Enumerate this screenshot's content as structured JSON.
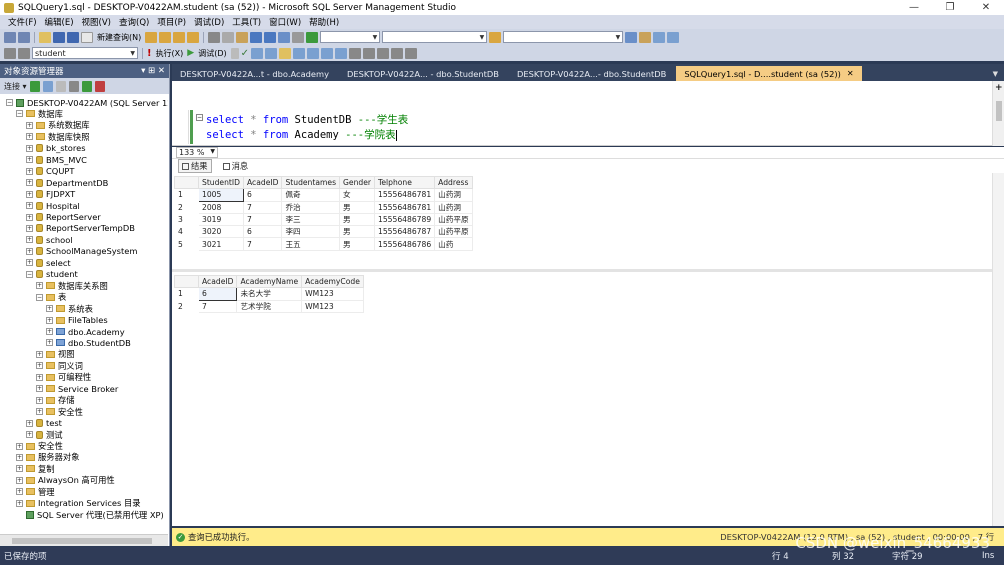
{
  "window": {
    "title": "SQLQuery1.sql - DESKTOP-V0422AM.student (sa (52)) - Microsoft SQL Server Management Studio",
    "minimize": "—",
    "maximize": "❐",
    "close": "✕"
  },
  "menu": [
    "文件(F)",
    "编辑(E)",
    "视图(V)",
    "查询(Q)",
    "项目(P)",
    "调试(D)",
    "工具(T)",
    "窗口(W)",
    "帮助(H)"
  ],
  "toolbar": {
    "new_query": "新建查询(N)",
    "database": "student",
    "execute": "执行(X)",
    "debug": "调试(D)"
  },
  "object_explorer": {
    "title": "对象资源管理器",
    "pin": "▾ ⊞ ✕",
    "connect": "连接 ▾",
    "tree": [
      {
        "label": "DESKTOP-V0422AM (SQL Server 12.0",
        "level": 0,
        "exp": "⊟",
        "icon": "server"
      },
      {
        "label": "数据库",
        "level": 1,
        "exp": "⊟",
        "icon": "folder"
      },
      {
        "label": "系统数据库",
        "level": 2,
        "exp": "⊞",
        "icon": "folder"
      },
      {
        "label": "数据库快照",
        "level": 2,
        "exp": "⊞",
        "icon": "folder"
      },
      {
        "label": "bk_stores",
        "level": 2,
        "exp": "⊞",
        "icon": "db"
      },
      {
        "label": "BMS_MVC",
        "level": 2,
        "exp": "⊞",
        "icon": "db"
      },
      {
        "label": "CQUPT",
        "level": 2,
        "exp": "⊞",
        "icon": "db"
      },
      {
        "label": "DepartmentDB",
        "level": 2,
        "exp": "⊞",
        "icon": "db"
      },
      {
        "label": "FJDPXT",
        "level": 2,
        "exp": "⊞",
        "icon": "db"
      },
      {
        "label": "Hospital",
        "level": 2,
        "exp": "⊞",
        "icon": "db"
      },
      {
        "label": "ReportServer",
        "level": 2,
        "exp": "⊞",
        "icon": "db"
      },
      {
        "label": "ReportServerTempDB",
        "level": 2,
        "exp": "⊞",
        "icon": "db"
      },
      {
        "label": "school",
        "level": 2,
        "exp": "⊞",
        "icon": "db"
      },
      {
        "label": "SchoolManageSystem",
        "level": 2,
        "exp": "⊞",
        "icon": "db"
      },
      {
        "label": "select",
        "level": 2,
        "exp": "⊞",
        "icon": "db"
      },
      {
        "label": "student",
        "level": 2,
        "exp": "⊟",
        "icon": "db"
      },
      {
        "label": "数据库关系图",
        "level": 3,
        "exp": "⊞",
        "icon": "folder"
      },
      {
        "label": "表",
        "level": 3,
        "exp": "⊟",
        "icon": "folder"
      },
      {
        "label": "系统表",
        "level": 4,
        "exp": "⊞",
        "icon": "folder"
      },
      {
        "label": "FileTables",
        "level": 4,
        "exp": "⊞",
        "icon": "folder"
      },
      {
        "label": "dbo.Academy",
        "level": 4,
        "exp": "⊞",
        "icon": "table"
      },
      {
        "label": "dbo.StudentDB",
        "level": 4,
        "exp": "⊞",
        "icon": "table"
      },
      {
        "label": "视图",
        "level": 3,
        "exp": "⊞",
        "icon": "folder"
      },
      {
        "label": "同义词",
        "level": 3,
        "exp": "⊞",
        "icon": "folder"
      },
      {
        "label": "可编程性",
        "level": 3,
        "exp": "⊞",
        "icon": "folder"
      },
      {
        "label": "Service Broker",
        "level": 3,
        "exp": "⊞",
        "icon": "folder"
      },
      {
        "label": "存储",
        "level": 3,
        "exp": "⊞",
        "icon": "folder"
      },
      {
        "label": "安全性",
        "level": 3,
        "exp": "⊞",
        "icon": "folder"
      },
      {
        "label": "test",
        "level": 2,
        "exp": "⊞",
        "icon": "db"
      },
      {
        "label": "测试",
        "level": 2,
        "exp": "⊞",
        "icon": "db"
      },
      {
        "label": "安全性",
        "level": 1,
        "exp": "⊞",
        "icon": "folder"
      },
      {
        "label": "服务器对象",
        "level": 1,
        "exp": "⊞",
        "icon": "folder"
      },
      {
        "label": "复制",
        "level": 1,
        "exp": "⊞",
        "icon": "folder"
      },
      {
        "label": "AlwaysOn 高可用性",
        "level": 1,
        "exp": "⊞",
        "icon": "folder"
      },
      {
        "label": "管理",
        "level": 1,
        "exp": "⊞",
        "icon": "folder"
      },
      {
        "label": "Integration Services 目录",
        "level": 1,
        "exp": "⊞",
        "icon": "folder"
      },
      {
        "label": "SQL Server 代理(已禁用代理 XP)",
        "level": 1,
        "exp": "",
        "icon": "agent"
      }
    ]
  },
  "tabs": [
    {
      "label": "DESKTOP-V0422A...t - dbo.Academy",
      "active": false
    },
    {
      "label": "DESKTOP-V0422A... - dbo.StudentDB",
      "active": false
    },
    {
      "label": "DESKTOP-V0422A...- dbo.StudentDB",
      "active": false
    },
    {
      "label": "SQLQuery1.sql - D....student (sa (52))",
      "active": true
    }
  ],
  "editor": {
    "line1": {
      "kw1": "select",
      "op": "*",
      "kw2": "from",
      "table": "StudentDB",
      "comment": "---学生表"
    },
    "line2": {
      "kw1": "select",
      "op": "*",
      "kw2": "from",
      "table": "Academy",
      "comment": "---学院表"
    },
    "zoom": "133 %"
  },
  "result_tabs": {
    "results": "结果",
    "messages": "消息"
  },
  "grid1": {
    "columns": [
      "StudentID",
      "AcadeID",
      "Studentames",
      "Gender",
      "Telphone",
      "Address"
    ],
    "rows": [
      [
        "1",
        "1005",
        "6",
        "佩奇",
        "女",
        "15556486781",
        "山药洞"
      ],
      [
        "2",
        "2008",
        "7",
        "乔治",
        "男",
        "15556486781",
        "山药洞"
      ],
      [
        "3",
        "3019",
        "7",
        "李三",
        "男",
        "15556486789",
        "山药平原"
      ],
      [
        "4",
        "3020",
        "6",
        "李四",
        "男",
        "15556486787",
        "山药平原"
      ],
      [
        "5",
        "3021",
        "7",
        "王五",
        "男",
        "15556486786",
        "山药"
      ]
    ]
  },
  "grid2": {
    "columns": [
      "AcadeID",
      "AcademyName",
      "AcademyCode"
    ],
    "rows": [
      [
        "1",
        "6",
        "未名大学",
        "WM123"
      ],
      [
        "2",
        "7",
        "艺术学院",
        "WM123"
      ]
    ]
  },
  "query_status": {
    "message": "查询已成功执行。",
    "right": "DESKTOP-V0422AM (12.0 RTM) , sa (52) , student , 00:00:00 , 7 行"
  },
  "status_bar": {
    "left": "已保存的项",
    "row": "行 4",
    "col": "列 32",
    "char": "字符 29",
    "ins": "Ins"
  },
  "watermark": "CSDN @weixin_54664933"
}
